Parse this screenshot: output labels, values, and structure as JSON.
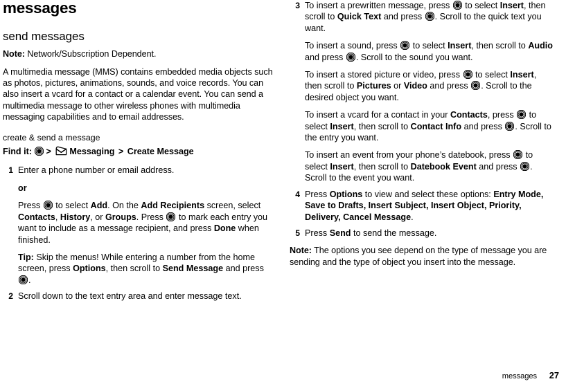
{
  "document": {
    "chapter_title": "messages",
    "footer": {
      "label": "messages",
      "page_number": "27"
    }
  },
  "left_column": {
    "section_title": "send messages",
    "note_label": "Note:",
    "note_text": " Network/Subscription Dependent.",
    "intro_paragraph": "A multimedia message (MMS) contains embedded media objects such as photos, pictures, animations, sounds, and voice records. You can also insert a vcard for a contact or a calendar event. You can send a multimedia message to other wireless phones with multimedia messaging capabilities and to email addresses.",
    "sub_title": "create & send a message",
    "find_it": {
      "label": "Find it:",
      "select_key_icon": "center-select-key-icon",
      "separator_1": ">",
      "messaging_icon": "envelope-icon",
      "messaging_label": "Messaging",
      "separator_2": ">",
      "create_message_label": "Create Message"
    },
    "steps": [
      {
        "number": "1",
        "text": "Enter a phone number or email address.",
        "or_label": "or",
        "press_1_pre": "Press ",
        "press_1_mid": " to select ",
        "add_bold": "Add",
        "press_1_post": ". On the ",
        "add_recipients_bold": "Add Recipients",
        "press_1_tail": " screen, select ",
        "contacts_bold": "Contacts",
        "comma_1": ", ",
        "history_bold": "History",
        "or_text": ", or ",
        "groups_bold": "Groups",
        "period_1": ". ",
        "press_2_pre": "Press ",
        "press_2_mid": " to mark each entry you want to include as a message recipient, and press ",
        "done_bold": "Done",
        "press_2_post": " when finished.",
        "tip_label": "Tip:",
        "tip_pre": " Skip the menus! While entering a number from the home screen, press ",
        "options_bold": "Options",
        "tip_mid": ", then scroll to ",
        "send_message_bold": "Send Message",
        "tip_post": " and press ",
        "tip_tail": "."
      },
      {
        "number": "2",
        "text": "Scroll down to the text entry area and enter message text."
      }
    ]
  },
  "right_column": {
    "steps": [
      {
        "number": "3",
        "para_quicktext": {
          "pre": "To insert a prewritten message, press ",
          "mid": " to select ",
          "insert_bold": "Insert",
          "post": ", then scroll to ",
          "quick_text_bold": "Quick Text",
          "tail": " and press ",
          "end": ". Scroll to the quick text you want."
        },
        "para_sound": {
          "pre": "To insert a sound, press ",
          "mid": " to select ",
          "insert_bold": "Insert",
          "post": ", then scroll to ",
          "audio_bold": "Audio",
          "tail": " and press ",
          "end": ". Scroll to the sound you want."
        },
        "para_picture": {
          "pre": "To insert a stored picture or video, press ",
          "mid": " to select ",
          "insert_bold": "Insert",
          "post": ", then scroll to ",
          "pictures_bold": "Pictures",
          "or_text": " or ",
          "video_bold": "Video",
          "tail": " and press ",
          "end": ". Scroll to the desired object you want."
        },
        "para_vcard": {
          "pre": "To insert a vcard for a contact in your ",
          "contacts_bold": "Contacts",
          "mid": ", press ",
          "mid2": " to select ",
          "insert_bold": "Insert",
          "post": ", then scroll to ",
          "contact_info_bold": "Contact Info",
          "tail": " and press ",
          "end": ". Scroll to the entry you want."
        },
        "para_event": {
          "pre": "To insert an event from your phone’s datebook, press ",
          "mid": " to select ",
          "insert_bold": "Insert",
          "post": ", then scroll to ",
          "datebook_event_bold": "Datebook Event",
          "tail": " and press ",
          "end": ". Scroll to the event you want."
        }
      },
      {
        "number": "4",
        "pre": "Press ",
        "options_bold": "Options",
        "mid": " to view and select these options: ",
        "options_list": [
          "Entry Mode",
          "Save to Drafts",
          "Insert Subject",
          "Insert Object",
          "Priority",
          "Delivery",
          "Cancel Message"
        ],
        "end": "."
      },
      {
        "number": "5",
        "pre": "Press ",
        "send_bold": "Send",
        "post": " to send the message."
      }
    ],
    "note_label": "Note:",
    "note_text": " The options you see depend on the type of message you are sending and the type of object you insert into the message."
  }
}
